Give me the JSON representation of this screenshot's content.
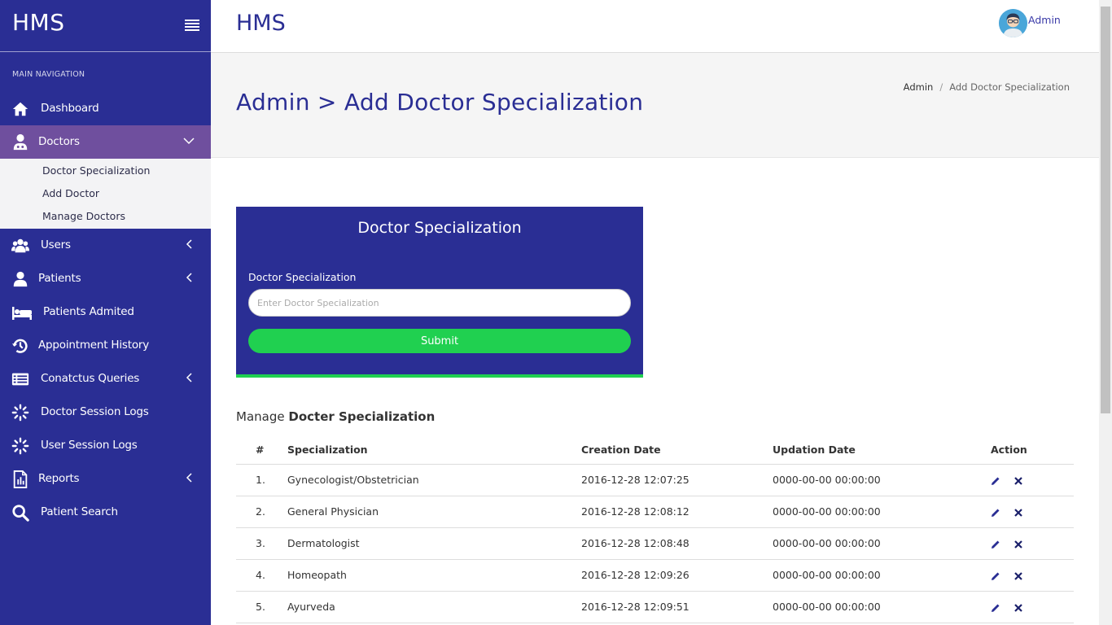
{
  "brand": {
    "title": "HMS"
  },
  "sidebar": {
    "header": "MAIN NAVIGATION",
    "items": [
      {
        "label": "Dashboard",
        "icon": "home-icon"
      },
      {
        "label": "Doctors",
        "icon": "doctor-icon",
        "expanded": true,
        "children": [
          "Doctor Specialization",
          "Add Doctor",
          "Manage Doctors"
        ]
      },
      {
        "label": "Users",
        "icon": "users-icon"
      },
      {
        "label": "Patients",
        "icon": "user-icon"
      },
      {
        "label": "Patients Admited",
        "icon": "bed-icon"
      },
      {
        "label": "Appointment History",
        "icon": "history-icon"
      },
      {
        "label": "Conatctus Queries",
        "icon": "list-icon"
      },
      {
        "label": "Doctor Session Logs",
        "icon": "spinner-icon"
      },
      {
        "label": "User Session Logs",
        "icon": "spinner-icon"
      },
      {
        "label": "Reports",
        "icon": "report-icon"
      },
      {
        "label": "Patient Search",
        "icon": "search-icon"
      }
    ]
  },
  "topbar": {
    "title": "HMS",
    "user": "Admin"
  },
  "page": {
    "title": "Admin > Add Doctor Specialization",
    "breadcrumb": [
      "Admin",
      "/",
      "Add Doctor Specialization"
    ]
  },
  "form": {
    "title": "Doctor Specialization",
    "label": "Doctor Specialization",
    "placeholder": "Enter Doctor Specialization",
    "submit": "Submit"
  },
  "manage": {
    "prefix": "Manage",
    "title": "Docter Specialization"
  },
  "table": {
    "headers": [
      "#",
      "Specialization",
      "Creation Date",
      "Updation Date",
      "Action"
    ],
    "rows": [
      {
        "num": "1.",
        "specialization": "Gynecologist/Obstetrician",
        "created": "2016-12-28 12:07:25",
        "updated": "0000-00-00 00:00:00"
      },
      {
        "num": "2.",
        "specialization": "General Physician",
        "created": "2016-12-28 12:08:12",
        "updated": "0000-00-00 00:00:00"
      },
      {
        "num": "3.",
        "specialization": "Dermatologist",
        "created": "2016-12-28 12:08:48",
        "updated": "0000-00-00 00:00:00"
      },
      {
        "num": "4.",
        "specialization": "Homeopath",
        "created": "2016-12-28 12:09:26",
        "updated": "0000-00-00 00:00:00"
      },
      {
        "num": "5.",
        "specialization": "Ayurveda",
        "created": "2016-12-28 12:09:51",
        "updated": "0000-00-00 00:00:00"
      }
    ]
  },
  "colors": {
    "primary": "#2a2e94",
    "active": "#6f4f9e",
    "accent": "#20d050"
  }
}
